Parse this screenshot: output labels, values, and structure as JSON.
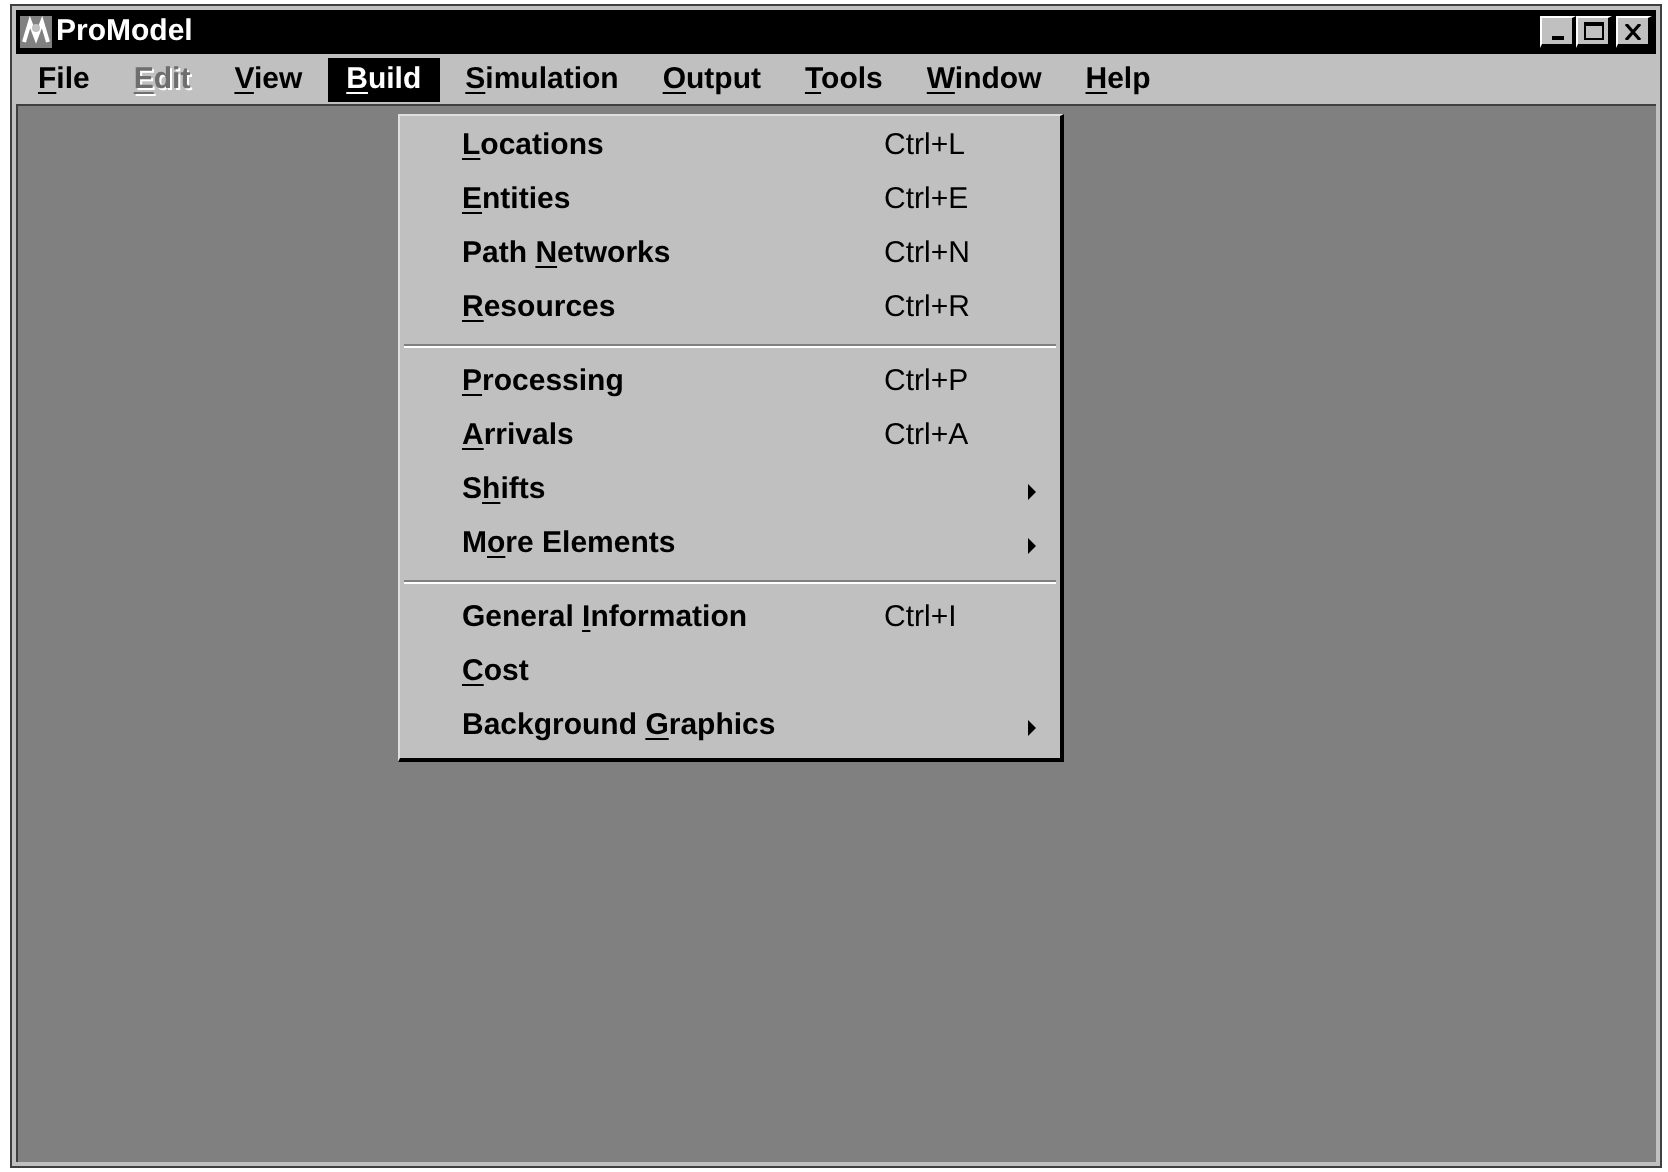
{
  "window": {
    "title": "ProModel"
  },
  "menu_bar": [
    {
      "key": "F",
      "after": "ile",
      "selected": false,
      "disabled": false
    },
    {
      "key": "E",
      "after": "dit",
      "selected": false,
      "disabled": true
    },
    {
      "key": "V",
      "after": "iew",
      "selected": false,
      "disabled": false
    },
    {
      "key": "B",
      "after": "uild",
      "selected": true,
      "disabled": false
    },
    {
      "key": "S",
      "after": "imulation",
      "selected": false,
      "disabled": false
    },
    {
      "key": "O",
      "after": "utput",
      "selected": false,
      "disabled": false
    },
    {
      "key": "T",
      "after": "ools",
      "selected": false,
      "disabled": false
    },
    {
      "key": "W",
      "after": "indow",
      "selected": false,
      "disabled": false
    },
    {
      "key": "H",
      "after": "elp",
      "selected": false,
      "disabled": false
    }
  ],
  "build_menu": [
    [
      {
        "key": "L",
        "after": "ocations",
        "shortcut": "Ctrl+L",
        "submenu": false
      },
      {
        "key": "E",
        "after": "ntities",
        "shortcut": "Ctrl+E",
        "submenu": false
      },
      {
        "before": "Path ",
        "key": "N",
        "after": "etworks",
        "shortcut": "Ctrl+N",
        "submenu": false
      },
      {
        "key": "R",
        "after": "esources",
        "shortcut": "Ctrl+R",
        "submenu": false
      }
    ],
    [
      {
        "key": "P",
        "after": "rocessing",
        "shortcut": "Ctrl+P",
        "submenu": false
      },
      {
        "key": "A",
        "after": "rrivals",
        "shortcut": "Ctrl+A",
        "submenu": false
      },
      {
        "before": "S",
        "key": "h",
        "after": "ifts",
        "submenu": true
      },
      {
        "before": "M",
        "key": "o",
        "after": "re Elements",
        "submenu": true
      }
    ],
    [
      {
        "before": "General ",
        "key": "I",
        "after": "nformation",
        "shortcut": "Ctrl+I",
        "submenu": false
      },
      {
        "key": "C",
        "after": "ost",
        "submenu": false
      },
      {
        "before": "Background ",
        "key": "G",
        "after": "raphics",
        "submenu": true
      }
    ]
  ]
}
